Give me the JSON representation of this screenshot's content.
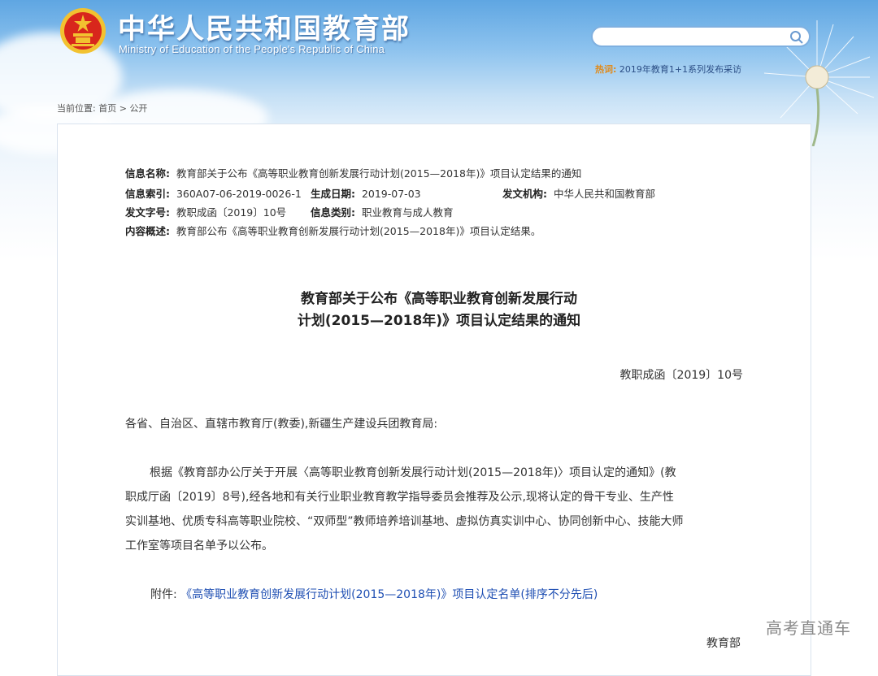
{
  "header": {
    "title": "中华人民共和国教育部",
    "subtitle": "Ministry of Education of the People's Republic of China",
    "search_placeholder": "",
    "hot_label": "热词:",
    "hot_text": "2019年教育1+1系列发布采访"
  },
  "breadcrumb": {
    "prefix": "当前位置:",
    "home": "首页",
    "separator": ">",
    "current": "公开"
  },
  "meta": {
    "name_label": "信息名称:",
    "name_value": "教育部关于公布《高等职业教育创新发展行动计划(2015—2018年)》项目认定结果的通知",
    "index_label": "信息索引:",
    "index_value": "360A07-06-2019-0026-1",
    "date_label": "生成日期:",
    "date_value": "2019-07-03",
    "org_label": "发文机构:",
    "org_value": "中华人民共和国教育部",
    "docno_label": "发文字号:",
    "docno_value": "教职成函〔2019〕10号",
    "category_label": "信息类别:",
    "category_value": "职业教育与成人教育",
    "summary_label": "内容概述:",
    "summary_value": "教育部公布《高等职业教育创新发展行动计划(2015—2018年)》项目认定结果。"
  },
  "document": {
    "title_line1": "教育部关于公布《高等职业教育创新发展行动",
    "title_line2": "计划(2015—2018年)》项目认定结果的通知",
    "doc_number": "教职成函〔2019〕10号",
    "salutation": "各省、自治区、直辖市教育厅(教委),新疆生产建设兵团教育局:",
    "body_lines": [
      "根据《教育部办公厅关于开展〈高等职业教育创新发展行动计划(2015—2018年)〉项目认定的通知》(教",
      "职成厅函〔2019〕8号),经各地和有关行业职业教育教学指导委员会推荐及公示,现将认定的骨干专业、生产性",
      "实训基地、优质专科高等职业院校、“双师型”教师培养培训基地、虚拟仿真实训中心、协同创新中心、技能大师",
      "工作室等项目名单予以公布。"
    ],
    "attachment_label": "附件:",
    "attachment_link": "《高等职业教育创新发展行动计划(2015—2018年)》项目认定名单(排序不分先后)",
    "signer": "教育部"
  },
  "watermark": "高考直通车",
  "colors": {
    "sky_top": "#5fa6e2",
    "link": "#1f4fb3",
    "hot_label": "#e08a1a",
    "emblem_red": "#d8261c",
    "emblem_gold": "#f2c230"
  }
}
